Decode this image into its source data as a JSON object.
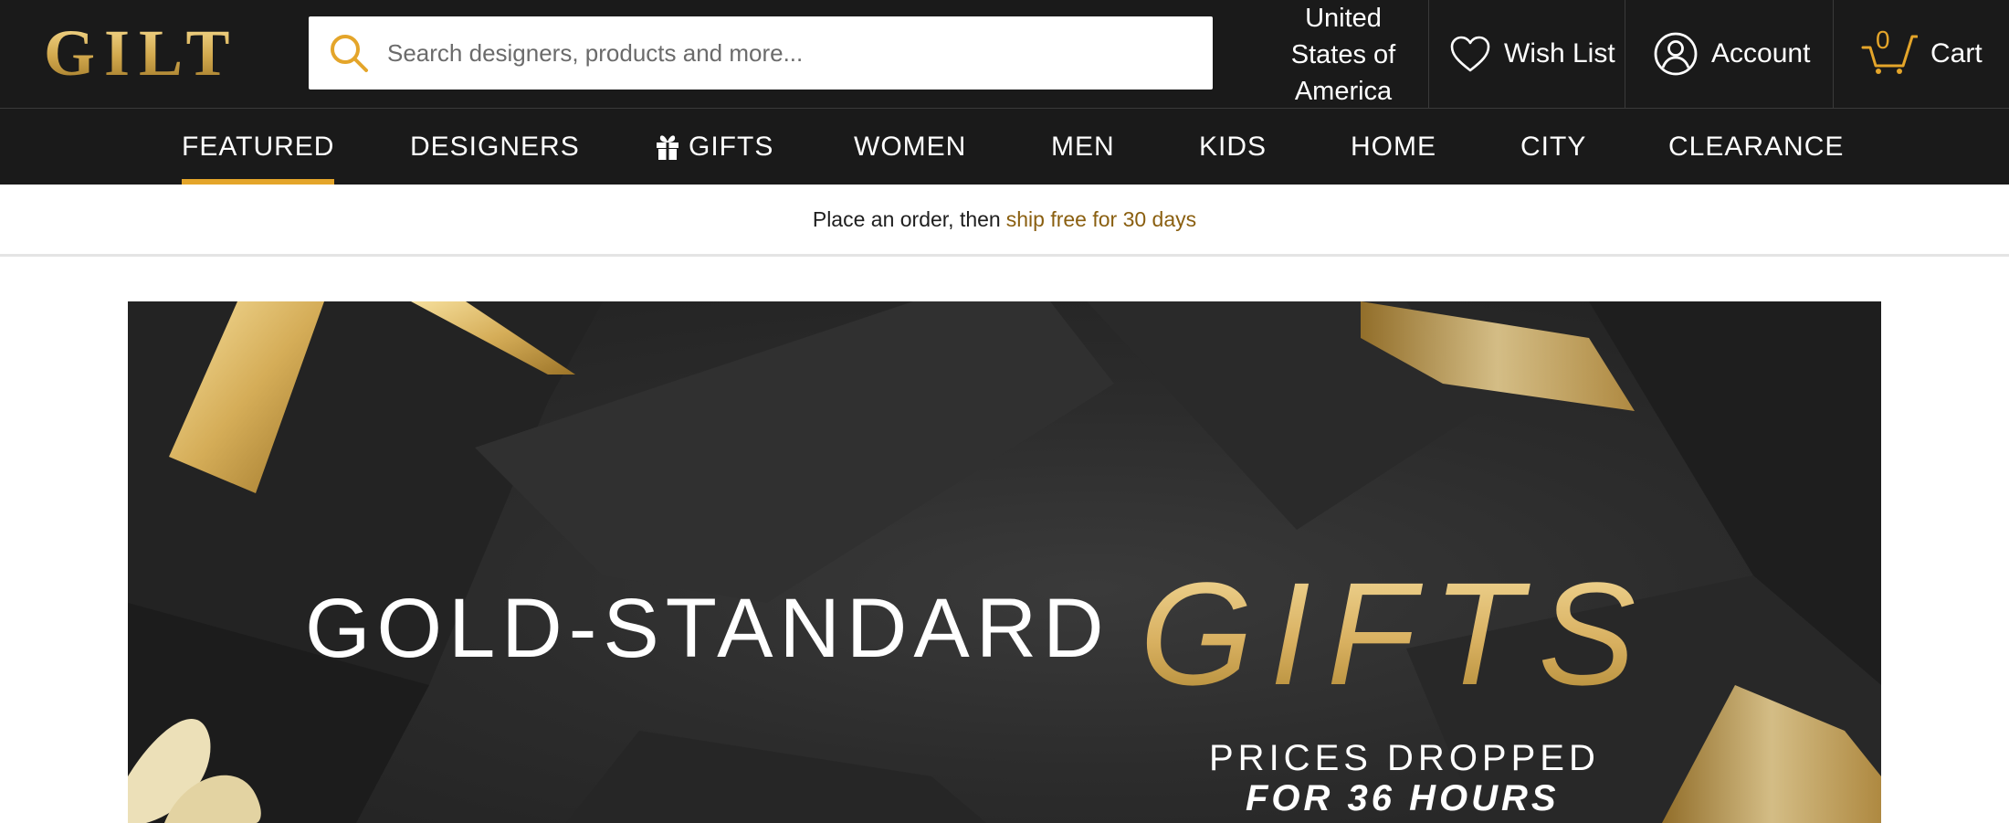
{
  "header": {
    "logo": "GILT",
    "search_placeholder": "Search designers, products and more...",
    "country": [
      "United",
      "States of",
      "America"
    ],
    "wish_list_label": "Wish List",
    "account_label": "Account",
    "cart_label": "Cart",
    "cart_count": "0"
  },
  "nav": {
    "items": [
      "FEATURED",
      "DESIGNERS",
      "GIFTS",
      "WOMEN",
      "MEN",
      "KIDS",
      "HOME",
      "CITY",
      "CLEARANCE"
    ],
    "active": "FEATURED"
  },
  "promo": {
    "text": "Place an order, then",
    "highlight": "ship free for 30 days"
  },
  "hero": {
    "line1": "GOLD-STANDARD",
    "line2": "GIFTS",
    "sub1": "PRICES DROPPED",
    "sub2": "FOR 36 HOURS"
  },
  "colors": {
    "header_bg": "#1a1a1a",
    "accent_gold": "#e4a52a",
    "promo_highlight": "#8a5f10"
  },
  "icons": [
    "search-icon",
    "heart-icon",
    "user-icon",
    "cart-icon",
    "gift-icon"
  ]
}
